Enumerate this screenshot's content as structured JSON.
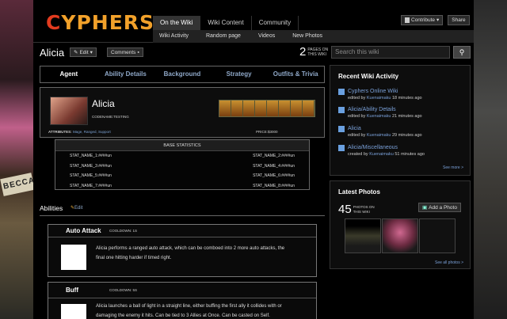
{
  "logo": "CYPHERS",
  "nav": {
    "tabs": [
      "On the Wiki",
      "Wiki Content",
      "Community"
    ],
    "sub": [
      "Wiki Activity",
      "Random page",
      "Videos",
      "New Photos"
    ]
  },
  "header_buttons": {
    "contribute": "Contribute",
    "share": "Share"
  },
  "page": {
    "title": "Alicia",
    "edit": "Edit",
    "comments": "Comments",
    "pages_count": "2",
    "pages_label_1": "PAGES ON",
    "pages_label_2": "THIS WIKI"
  },
  "search": {
    "placeholder": "Search this wiki"
  },
  "tabs": [
    "Agent",
    "Ability Details",
    "Background",
    "Strategy",
    "Outfits & Trivia"
  ],
  "character": {
    "name": "Alicia",
    "codename": "CODENAME:TESTING",
    "attributes_label": "ATTRIBUTES:",
    "attributes": "Mage, Ranged, Support",
    "price": "PRICE:$3000"
  },
  "stats": {
    "header": "BASE STATISTICS",
    "rows": [
      [
        "STAT_NAME_1:####un",
        "STAT_NAME_2:####un"
      ],
      [
        "STAT_NAME_3:####un",
        "STAT_NAME_4:####un"
      ],
      [
        "STAT_NAME_5:####un",
        "STAT_NAME_6:####un"
      ],
      [
        "STAT_NAME_7:####un",
        "STAT_NAME_8:####un"
      ]
    ]
  },
  "abilities": {
    "title": "Abilities",
    "edit": "Edit",
    "cards": [
      {
        "name": "Auto Attack",
        "cooldown": "COOLDOWN: 1S",
        "lines": [
          "Alicia performs a ranged auto attack, which can be comboed into 2 more auto attacks, the",
          "final one hitting harder if timed right."
        ]
      },
      {
        "name": "Buff",
        "cooldown": "COOLDOWN: 5S",
        "lines": [
          "Alicia launches a ball of light in a straight line, either buffing the first ally it collides with or",
          "damaging the enemy it hits. Can be tied to 3 Allies at Once. Can be casted on Self."
        ]
      }
    ]
  },
  "recent": {
    "title": "Recent Wiki Activity",
    "items": [
      {
        "title": "Cyphers Online Wiki",
        "verb": "edited by",
        "user": "Kuenaimaku",
        "time": "18 minutes ago"
      },
      {
        "title": "Alicia/Ability Details",
        "verb": "edited by",
        "user": "Kuenaimaku",
        "time": "21 minutes ago"
      },
      {
        "title": "Alicia",
        "verb": "edited by",
        "user": "Kuenaimaku",
        "time": "29 minutes ago"
      },
      {
        "title": "Alicia/Miscellaneous",
        "verb": "created by",
        "user": "Kuenaimaku",
        "time": "51 minutes ago"
      }
    ],
    "more": "See more >"
  },
  "photos": {
    "title": "Latest Photos",
    "count": "45",
    "label_1": "PHOTOS ON",
    "label_2": "THIS WIKI",
    "add": "Add a Photo",
    "see_all": "See all photos >"
  },
  "background_text": "BECCA"
}
